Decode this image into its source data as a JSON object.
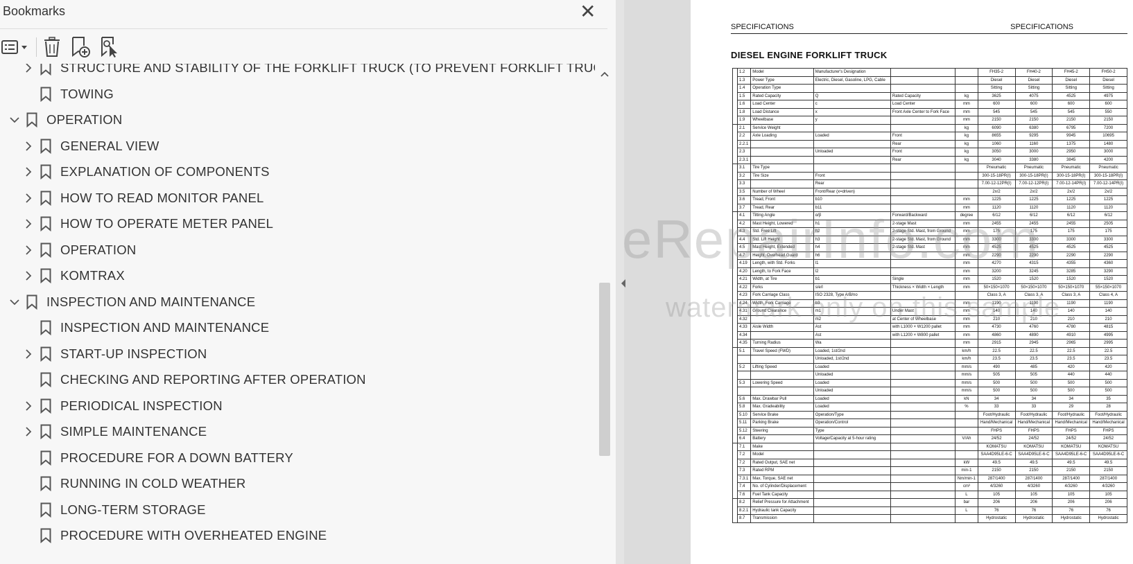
{
  "sidebar": {
    "title": "Bookmarks",
    "close_glyph": "✕",
    "toolbar": [
      "options-menu-icon",
      "delete-bookmark-icon",
      "new-bookmark-icon",
      "find-bookmark-icon"
    ],
    "items": [
      {
        "label": "STRUCTURE AND STABILITY OF THE FORKLIFT TRUCK (TO PREVENT FORKLIFT TRUCK FROM TIPPING)",
        "level": 1,
        "chevron": "right"
      },
      {
        "label": "TOWING",
        "level": 1,
        "chevron": "none"
      },
      {
        "label": "OPERATION",
        "level": 0,
        "chevron": "down"
      },
      {
        "label": "GENERAL VIEW",
        "level": 1,
        "chevron": "right"
      },
      {
        "label": "EXPLANATION OF COMPONENTS",
        "level": 1,
        "chevron": "right"
      },
      {
        "label": "HOW TO READ MONITOR PANEL",
        "level": 1,
        "chevron": "right"
      },
      {
        "label": "HOW TO OPERATE METER PANEL",
        "level": 1,
        "chevron": "right"
      },
      {
        "label": "OPERATION",
        "level": 1,
        "chevron": "right"
      },
      {
        "label": "KOMTRAX",
        "level": 1,
        "chevron": "right"
      },
      {
        "label": "INSPECTION AND MAINTENANCE",
        "level": 0,
        "chevron": "down"
      },
      {
        "label": "INSPECTION AND MAINTENANCE",
        "level": 1,
        "chevron": "none"
      },
      {
        "label": "START-UP INSPECTION",
        "level": 1,
        "chevron": "right"
      },
      {
        "label": "CHECKING AND REPORTING AFTER OPERATION",
        "level": 1,
        "chevron": "none"
      },
      {
        "label": "PERIODICAL INSPECTION",
        "level": 1,
        "chevron": "right"
      },
      {
        "label": "SIMPLE MAINTENANCE",
        "level": 1,
        "chevron": "right"
      },
      {
        "label": "PROCEDURE FOR A DOWN BATTERY",
        "level": 1,
        "chevron": "none"
      },
      {
        "label": "RUNNING IN COLD WEATHER",
        "level": 1,
        "chevron": "none"
      },
      {
        "label": "LONG-TERM STORAGE",
        "level": 1,
        "chevron": "none"
      },
      {
        "label": "PROCEDURE WITH OVERHEATED ENGINE",
        "level": 1,
        "chevron": "none"
      }
    ]
  },
  "document": {
    "header_left": "SPECIFICATIONS",
    "header_right": "SPECIFICATIONS",
    "title": "DIESEL ENGINE FORKLIFT TRUCK",
    "watermark": "eRepairInfo.com",
    "watermark_sub": "watermark only on this sample",
    "models": [
      "FH35-2",
      "FH40-2",
      "FH45-2",
      "FH50-2"
    ],
    "rows": [
      {
        "g": "Characteristics",
        "n": "1.2",
        "name": "Model",
        "sym": "Manufacturer's Designation",
        "desc": "",
        "unit": "",
        "v": [
          "FH35-2",
          "FH40-2",
          "FH45-2",
          "FH50-2"
        ]
      },
      {
        "g": "",
        "n": "1.3",
        "name": "Power Type",
        "sym": "Electric, Diesel, Gasoline, LPG, Cable",
        "desc": "",
        "unit": "",
        "v": [
          "Diesel",
          "Diesel",
          "Diesel",
          "Diesel"
        ]
      },
      {
        "g": "",
        "n": "1.4",
        "name": "Operation Type",
        "sym": "",
        "desc": "",
        "unit": "",
        "v": [
          "Sitting",
          "Sitting",
          "Sitting",
          "Sitting"
        ]
      },
      {
        "g": "",
        "n": "1.5",
        "name": "Rated Capacity",
        "sym": "Q",
        "desc": "Rated Capacity",
        "unit": "kg",
        "v": [
          "3625",
          "4075",
          "4525",
          "4975"
        ]
      },
      {
        "g": "",
        "n": "1.6",
        "name": "Load Center",
        "sym": "c",
        "desc": "Load Center",
        "unit": "mm",
        "v": [
          "600",
          "600",
          "600",
          "600"
        ]
      },
      {
        "g": "",
        "n": "1.8",
        "name": "Load Distance",
        "sym": "x",
        "desc": "Front Axle Center to Fork Face",
        "unit": "mm",
        "v": [
          "545",
          "545",
          "545",
          "550"
        ]
      },
      {
        "g": "",
        "n": "1.9",
        "name": "Wheelbase",
        "sym": "y",
        "desc": "",
        "unit": "mm",
        "v": [
          "2150",
          "2150",
          "2150",
          "2150"
        ]
      },
      {
        "g": "Weight",
        "n": "2.1",
        "name": "Service Weight",
        "sym": "",
        "desc": "",
        "unit": "kg",
        "v": [
          "6090",
          "6380",
          "6795",
          "7200"
        ]
      },
      {
        "g": "",
        "n": "2.2",
        "name": "Axle Loading",
        "sym": "Loaded",
        "desc": "Front",
        "unit": "kg",
        "v": [
          "8655",
          "9295",
          "9945",
          "10695"
        ]
      },
      {
        "g": "",
        "n": "2.2.1",
        "name": "",
        "sym": "",
        "desc": "Rear",
        "unit": "kg",
        "v": [
          "1060",
          "1160",
          "1375",
          "1480"
        ]
      },
      {
        "g": "",
        "n": "2.3",
        "name": "",
        "sym": "Unloaded",
        "desc": "Front",
        "unit": "kg",
        "v": [
          "3050",
          "3000",
          "2950",
          "3000"
        ]
      },
      {
        "g": "",
        "n": "2.3.1",
        "name": "",
        "sym": "",
        "desc": "Rear",
        "unit": "kg",
        "v": [
          "3040",
          "3380",
          "3845",
          "4200"
        ]
      },
      {
        "g": "Tires",
        "n": "3.1",
        "name": "Tire Type",
        "sym": "",
        "desc": "",
        "unit": "",
        "v": [
          "Pneumatic",
          "Pneumatic",
          "Pneumatic",
          "Pneumatic"
        ]
      },
      {
        "g": "",
        "n": "3.2",
        "name": "Tire Size",
        "sym": "Front",
        "desc": "",
        "unit": "",
        "v": [
          "300-15-18PR(I)",
          "300-15-18PR(I)",
          "300-15-18PR(I)",
          "300-15-18PR(I)"
        ]
      },
      {
        "g": "",
        "n": "3.3",
        "name": "",
        "sym": "Rear",
        "desc": "",
        "unit": "",
        "v": [
          "7.00-12-12PR(I)",
          "7.00-12-12PR(I)",
          "7.00-12-14PR(I)",
          "7.00-12-14PR(I)"
        ]
      },
      {
        "g": "",
        "n": "3.5",
        "name": "Number of Wheel",
        "sym": "Front/Rear (x=driven)",
        "desc": "",
        "unit": "",
        "v": [
          "2x/2",
          "2x/2",
          "2x/2",
          "2x/2"
        ]
      },
      {
        "g": "",
        "n": "3.6",
        "name": "Tread, Front",
        "sym": "b10",
        "desc": "",
        "unit": "mm",
        "v": [
          "1225",
          "1225",
          "1225",
          "1225"
        ]
      },
      {
        "g": "",
        "n": "3.7",
        "name": "Tread, Rear",
        "sym": "b11",
        "desc": "",
        "unit": "mm",
        "v": [
          "1120",
          "1120",
          "1120",
          "1120"
        ]
      },
      {
        "g": "Dimensions",
        "n": "4.1",
        "name": "Tilting Angle",
        "sym": "α/β",
        "desc": "Forward/Backward",
        "unit": "degree",
        "v": [
          "6/12",
          "6/12",
          "6/12",
          "6/12"
        ]
      },
      {
        "g": "",
        "n": "4.2",
        "name": "Mast Height, Lowered",
        "sym": "h1",
        "desc": "2-stage Mast",
        "unit": "mm",
        "v": [
          "2455",
          "2455",
          "2455",
          "2505"
        ]
      },
      {
        "g": "",
        "n": "4.3",
        "name": "Std. Free Lift",
        "sym": "h2",
        "desc": "2-stage Std. Mast, from Ground",
        "unit": "mm",
        "v": [
          "175",
          "175",
          "175",
          "175"
        ]
      },
      {
        "g": "",
        "n": "4.4",
        "name": "Std. Lift Height",
        "sym": "h3",
        "desc": "2-stage Std. Mast, from Ground",
        "unit": "mm",
        "v": [
          "3300",
          "3300",
          "3300",
          "3300"
        ]
      },
      {
        "g": "",
        "n": "4.5",
        "name": "Mast Height, Extended",
        "sym": "h4",
        "desc": "2-stage Std. Mast",
        "unit": "mm",
        "v": [
          "4525",
          "4525",
          "4525",
          "4525"
        ]
      },
      {
        "g": "",
        "n": "4.7",
        "name": "Height, Overhead Guard",
        "sym": "h6",
        "desc": "",
        "unit": "mm",
        "v": [
          "2290",
          "2290",
          "2290",
          "2290"
        ]
      },
      {
        "g": "",
        "n": "4.19",
        "name": "Length, with Std. Forks",
        "sym": "l1",
        "desc": "",
        "unit": "mm",
        "v": [
          "4270",
          "4315",
          "4355",
          "4360"
        ]
      },
      {
        "g": "",
        "n": "4.20",
        "name": "Length, to Fork Face",
        "sym": "l2",
        "desc": "",
        "unit": "mm",
        "v": [
          "3200",
          "3245",
          "3285",
          "3290"
        ]
      },
      {
        "g": "",
        "n": "4.21",
        "name": "Width, at Tire",
        "sym": "b1",
        "desc": "Single",
        "unit": "mm",
        "v": [
          "1520",
          "1520",
          "1520",
          "1520"
        ]
      },
      {
        "g": "",
        "n": "4.22",
        "name": "Forks",
        "sym": "s/e/l",
        "desc": "Thickness × Width × Length",
        "unit": "mm",
        "v": [
          "50×150×1070",
          "50×150×1070",
          "50×150×1070",
          "55×150×1070"
        ]
      },
      {
        "g": "",
        "n": "4.23",
        "name": "Fork Carriage Class",
        "sym": "ISO 2328, Type A/B/no",
        "desc": "",
        "unit": "",
        "v": [
          "Class 3, A",
          "Class 3, A",
          "Class 3, A",
          "Class 4, A"
        ]
      },
      {
        "g": "",
        "n": "4.24",
        "name": "Width, Fork Carriage",
        "sym": "b3",
        "desc": "",
        "unit": "mm",
        "v": [
          "1190",
          "1190",
          "1190",
          "1190"
        ]
      },
      {
        "g": "",
        "n": "4.31",
        "name": "Ground Clearance",
        "sym": "m1",
        "desc": "Under Mast",
        "unit": "mm",
        "v": [
          "140",
          "140",
          "140",
          "140"
        ]
      },
      {
        "g": "",
        "n": "4.32",
        "name": "",
        "sym": "m2",
        "desc": "at Center of Wheelbase",
        "unit": "mm",
        "v": [
          "210",
          "210",
          "210",
          "210"
        ]
      },
      {
        "g": "",
        "n": "4.33",
        "name": "Aisle Width",
        "sym": "Ast",
        "desc": "with L1000 × W1200 pallet",
        "unit": "mm",
        "v": [
          "4730",
          "4760",
          "4780",
          "4815"
        ]
      },
      {
        "g": "",
        "n": "4.34",
        "name": "",
        "sym": "Ast",
        "desc": "with L1200 × W800 pallet",
        "unit": "mm",
        "v": [
          "4860",
          "4890",
          "4910",
          "4995"
        ]
      },
      {
        "g": "",
        "n": "4.35",
        "name": "Turning Radius",
        "sym": "Wa",
        "desc": "",
        "unit": "mm",
        "v": [
          "2915",
          "2945",
          "2965",
          "2995"
        ]
      },
      {
        "g": "Performance",
        "n": "5.1",
        "name": "Travel Speed (FWD)",
        "sym": "Loaded, 1st/2nd",
        "desc": "",
        "unit": "km/h",
        "v": [
          "22.5",
          "22.5",
          "22.5",
          "22.5"
        ]
      },
      {
        "g": "",
        "n": "",
        "name": "",
        "sym": "Unloaded, 1st/2nd",
        "desc": "",
        "unit": "km/h",
        "v": [
          "23.5",
          "23.5",
          "23.5",
          "23.5"
        ]
      },
      {
        "g": "",
        "n": "5.2",
        "name": "Lifting Speed",
        "sym": "Loaded",
        "desc": "",
        "unit": "mm/s",
        "v": [
          "490",
          "485",
          "420",
          "420"
        ]
      },
      {
        "g": "",
        "n": "",
        "name": "",
        "sym": "Unloaded",
        "desc": "",
        "unit": "mm/s",
        "v": [
          "505",
          "505",
          "440",
          "440"
        ]
      },
      {
        "g": "",
        "n": "5.3",
        "name": "Lowering Speed",
        "sym": "Loaded",
        "desc": "",
        "unit": "mm/s",
        "v": [
          "500",
          "500",
          "500",
          "500"
        ]
      },
      {
        "g": "",
        "n": "",
        "name": "",
        "sym": "Unloaded",
        "desc": "",
        "unit": "mm/s",
        "v": [
          "500",
          "500",
          "500",
          "500"
        ]
      },
      {
        "g": "",
        "n": "5.6",
        "name": "Max. Drawbar Pull",
        "sym": "Loaded",
        "desc": "",
        "unit": "kN",
        "v": [
          "34",
          "34",
          "34",
          "35"
        ]
      },
      {
        "g": "",
        "n": "5.8",
        "name": "Max. Gradeability",
        "sym": "Loaded",
        "desc": "",
        "unit": "%",
        "v": [
          "33",
          "33",
          "29",
          "28"
        ]
      },
      {
        "g": "",
        "n": "5.10",
        "name": "Service Brake",
        "sym": "Operation/Type",
        "desc": "",
        "unit": "",
        "v": [
          "Foot/Hydraulic",
          "Foot/Hydraulic",
          "Foot/Hydraulic",
          "Foot/Hydraulic"
        ]
      },
      {
        "g": "",
        "n": "5.11",
        "name": "Parking Brake",
        "sym": "Operation/Control",
        "desc": "",
        "unit": "",
        "v": [
          "Hand/Mechanical",
          "Hand/Mechanical",
          "Hand/Mechanical",
          "Hand/Mechanical"
        ]
      },
      {
        "g": "",
        "n": "5.12",
        "name": "Steering",
        "sym": "Type",
        "desc": "",
        "unit": "",
        "v": [
          "FHPS",
          "FHPS",
          "FHPS",
          "FHPS"
        ]
      },
      {
        "g": "",
        "n": "6.4",
        "name": "Battery",
        "sym": "Voltage/Capacity at 5-hour rating",
        "desc": "",
        "unit": "V/Ah",
        "v": [
          "24/52",
          "24/52",
          "24/52",
          "24/52"
        ]
      },
      {
        "g": "I.C.Engine",
        "n": "7.1",
        "name": "Make",
        "sym": "",
        "desc": "",
        "unit": "",
        "v": [
          "KOMATSU",
          "KOMATSU",
          "KOMATSU",
          "KOMATSU"
        ]
      },
      {
        "g": "",
        "n": "7.2",
        "name": "Model",
        "sym": "",
        "desc": "",
        "unit": "",
        "v": [
          "SAA4D95LE-6-C",
          "SAA4D95LE-6-C",
          "SAA4D95LE-6-C",
          "SAA4D95LE-6-C"
        ]
      },
      {
        "g": "",
        "n": "7.2",
        "name": "Rated Output, SAE net",
        "sym": "",
        "desc": "",
        "unit": "kW",
        "v": [
          "49.5",
          "49.5",
          "49.5",
          "49.5"
        ]
      },
      {
        "g": "",
        "n": "7.3",
        "name": "Rated RPM",
        "sym": "",
        "desc": "",
        "unit": "min-1",
        "v": [
          "2150",
          "2150",
          "2150",
          "2150"
        ]
      },
      {
        "g": "",
        "n": "7.3.1",
        "name": "Max. Torque, SAE net",
        "sym": "",
        "desc": "",
        "unit": "Nm/min-1",
        "v": [
          "287/1400",
          "287/1400",
          "287/1400",
          "287/1400"
        ]
      },
      {
        "g": "",
        "n": "7.4",
        "name": "No. of Cylinder/Displacement",
        "sym": "",
        "desc": "",
        "unit": "cm³",
        "v": [
          "4/3260",
          "4/3260",
          "4/3260",
          "4/3260"
        ]
      },
      {
        "g": "",
        "n": "7.6",
        "name": "Fuel Tank Capacity",
        "sym": "",
        "desc": "",
        "unit": "L",
        "v": [
          "105",
          "105",
          "105",
          "105"
        ]
      },
      {
        "g": "Others",
        "n": "8.2",
        "name": "Relief Pressure for Attachment",
        "sym": "",
        "desc": "",
        "unit": "bar",
        "v": [
          "206",
          "206",
          "206",
          "206"
        ]
      },
      {
        "g": "",
        "n": "8.2.1",
        "name": "Hydraulic tank Capacity",
        "sym": "",
        "desc": "",
        "unit": "L",
        "v": [
          "76",
          "76",
          "76",
          "76"
        ]
      },
      {
        "g": "",
        "n": "8.7",
        "name": "Transmission",
        "sym": "",
        "desc": "",
        "unit": "",
        "v": [
          "Hydrostatic",
          "Hydrostatic",
          "Hydrostatic",
          "Hydrostatic"
        ]
      }
    ]
  }
}
